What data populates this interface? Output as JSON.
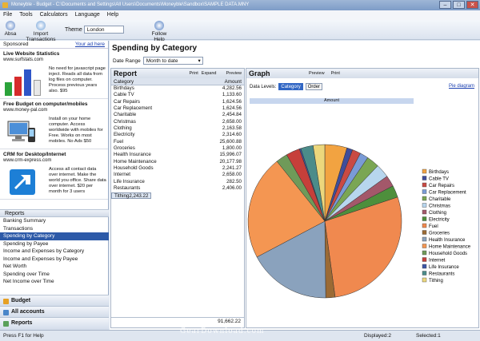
{
  "window": {
    "title": "Moneyble - Budget - C:\\Documents and Settings\\All Users\\Documents\\Moneyble\\Sandbox\\SAMPLE DATA.MNY"
  },
  "menu": [
    "File",
    "Tools",
    "Calculators",
    "Language",
    "Help"
  ],
  "toolbar": {
    "absa": "Absa",
    "import": "Import Transactions",
    "theme_label": "Theme",
    "theme_value": "London",
    "follow_help": "Follow Help"
  },
  "sponsored": {
    "label": "Sponsored",
    "link": "Your ad here",
    "ads": [
      {
        "title": "Live Website Statistics",
        "url": "www.surfstats.com",
        "text": "No need for javascript page inject. Reads all data from log files on computer. Process previous years also. $95"
      },
      {
        "title": "Free Budget on computer/mobiles",
        "url": "www.money-pal.com",
        "text": "Install on your home computer. Access worldwide with mobiles for Free. Works on most mobiles. No Ads $50"
      },
      {
        "title": "CRM for Desktop/Internet",
        "url": "www.crm-express.com",
        "text": "Access all contact data over internet. Make the world you office. Share data over internet. $20 per month for 3 users"
      }
    ]
  },
  "nav": {
    "header": "Reports",
    "items": [
      "Banking Summary",
      "Transactions",
      "Spending by Category",
      "Spending by Payee",
      "Income and Expenses by Category",
      "Income and Expenses by Payee",
      "Net Worth",
      "Spending over Time",
      "Net Income over Time"
    ],
    "selected": "Spending by Category",
    "bottom": [
      "Budget",
      "All accounts",
      "Reports"
    ]
  },
  "main": {
    "title": "Spending by Category",
    "date_range_label": "Date Range",
    "date_range_value": "Month to date"
  },
  "report": {
    "title": "Report",
    "actions": [
      "Print",
      "Expand",
      "Preview"
    ],
    "col_category": "Category",
    "col_amount": "Amount",
    "rows": [
      [
        "Birthdays",
        "4,282.56"
      ],
      [
        "Cable TV",
        "1,133.60"
      ],
      [
        "Car Repairs",
        "1,624.56"
      ],
      [
        "Car Replacement",
        "1,624.56"
      ],
      [
        "Charitable",
        "2,454.84"
      ],
      [
        "Christmas",
        "2,658.00"
      ],
      [
        "Clothing",
        "2,163.58"
      ],
      [
        "Electricity",
        "2,314.60"
      ],
      [
        "Fuel",
        "25,600.88"
      ],
      [
        "Groceries",
        "1,800.00"
      ],
      [
        "Health Insurance",
        "15,996.07"
      ],
      [
        "Home Maintenance",
        "20,177.98"
      ],
      [
        "Household Goods",
        "2,241.27"
      ],
      [
        "Internet",
        "2,658.00"
      ],
      [
        "Life Insurance",
        "282.50"
      ],
      [
        "Restaurants",
        "2,406.00"
      ],
      [
        "Tithing",
        "2,243.22"
      ]
    ],
    "selected_row": "Tithing",
    "total": "91,662.22"
  },
  "graph": {
    "title": "Graph",
    "actions": [
      "Preview",
      "Print"
    ],
    "data_levels_label": "Data Levels:",
    "levels": [
      "Category",
      "Order"
    ],
    "pie_link": "Pie diagram",
    "amount_header": "Amount"
  },
  "chart_data": {
    "type": "pie",
    "categories": [
      "Birthdays",
      "Cable TV",
      "Car Repairs",
      "Car Replacement",
      "Charitable",
      "Christmas",
      "Clothing",
      "Electricity",
      "Fuel",
      "Groceries",
      "Health Insurance",
      "Home Maintenance",
      "Household Goods",
      "Internet",
      "Life Insurance",
      "Restaurants",
      "Tithing"
    ],
    "values": [
      4282.56,
      1133.6,
      1624.56,
      1624.56,
      2454.84,
      2658.0,
      2163.58,
      2314.6,
      25600.88,
      1800.0,
      15996.07,
      20177.98,
      2241.27,
      2658.0,
      282.5,
      2406.0,
      2243.22
    ],
    "colors": [
      "#f2a341",
      "#3f4d9b",
      "#c94a43",
      "#7a9bd6",
      "#7aa654",
      "#b7d6ee",
      "#a3586a",
      "#4e8f3c",
      "#f0894f",
      "#9b6a34",
      "#8aa2bd",
      "#f49652",
      "#6f9a59",
      "#c63f3a",
      "#3c56a6",
      "#4b8c8a",
      "#ecd77c"
    ],
    "legend": "right"
  },
  "status": {
    "help": "Press F1 for Help",
    "displayed": "Displayed:2",
    "selected": "Selected:1"
  },
  "watermark": "GearDownload.com"
}
